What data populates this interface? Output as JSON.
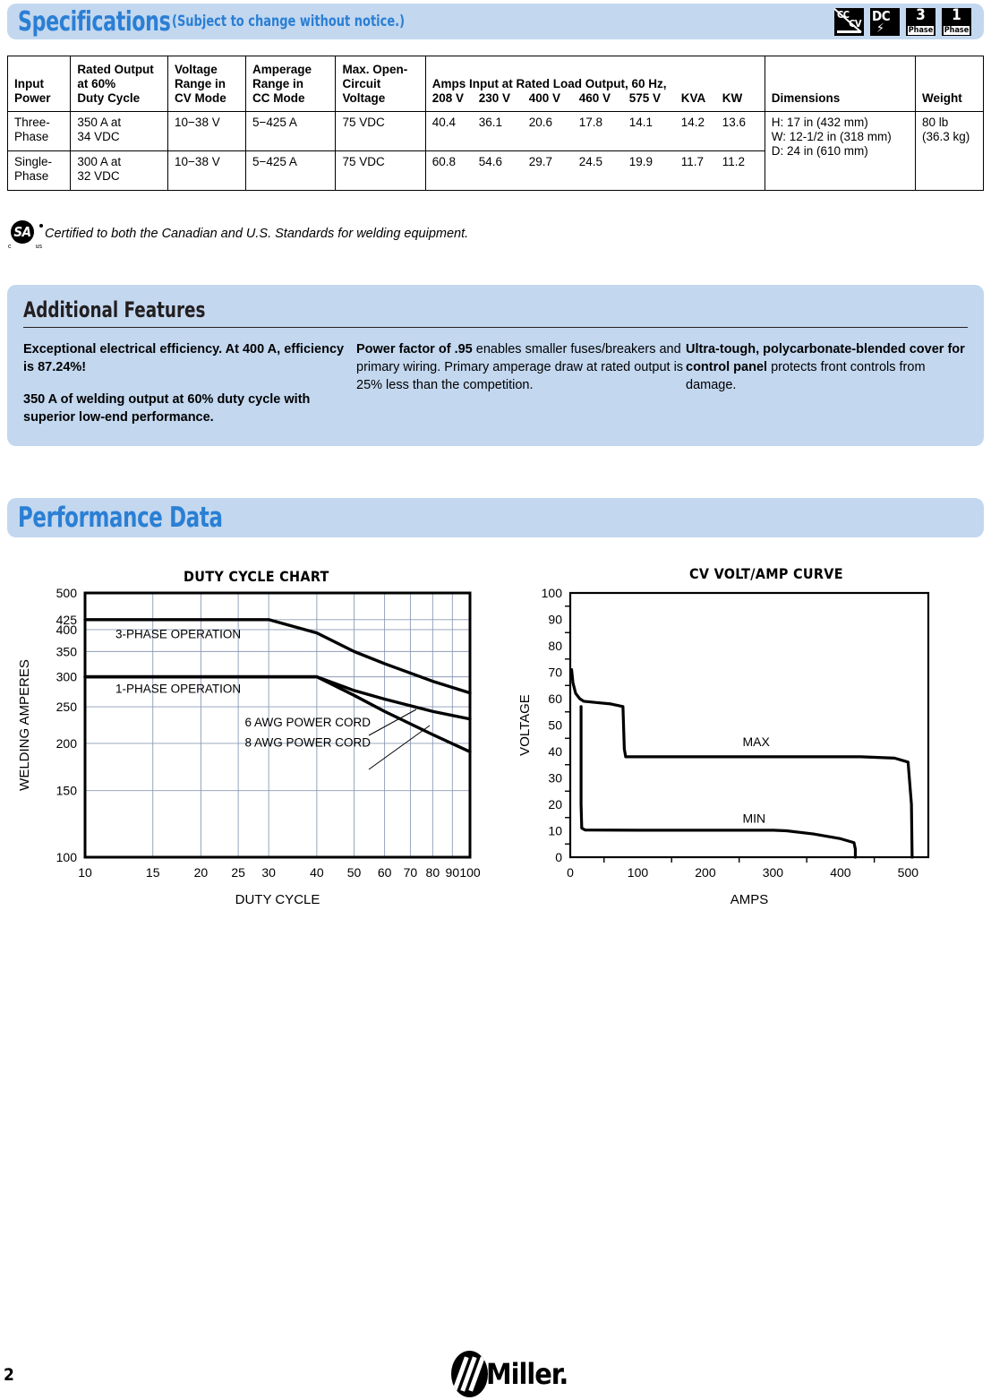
{
  "header": {
    "title": "Specifications",
    "subtitle": "(Subject to change without notice.)",
    "badges": [
      {
        "name": "cc-cv-badge",
        "top": "CC",
        "bottom": "CV"
      },
      {
        "name": "dc-badge",
        "label": "DC"
      },
      {
        "name": "three-phase-badge",
        "number": "3",
        "caption": "Phase"
      },
      {
        "name": "single-phase-badge",
        "number": "1",
        "caption": "Phase"
      }
    ]
  },
  "spec_table": {
    "columns": [
      "Input\nPower",
      "Rated Output\nat 60%\nDuty Cycle",
      "Voltage\nRange in\nCV Mode",
      "Amperage\nRange in\nCC Mode",
      "Max. Open-\nCircuit\nVoltage",
      "Amps Input at Rated Load Output, 60 Hz,",
      "Dimensions",
      "Weight"
    ],
    "col_input_power": {
      "l1": "Input",
      "l2": "Power"
    },
    "col_rated_output": {
      "l1": "Rated Output",
      "l2": "at 60%",
      "l3": "Duty Cycle"
    },
    "col_voltage_range": {
      "l1": "Voltage",
      "l2": "Range in",
      "l3": "CV Mode"
    },
    "col_amperage_range": {
      "l1": "Amperage",
      "l2": "Range in",
      "l3": "CC Mode"
    },
    "col_max_ocv": {
      "l1": "Max. Open-",
      "l2": "Circuit",
      "l3": "Voltage"
    },
    "amps_header": {
      "title": "Amps Input at Rated Load Output, 60 Hz,",
      "subheaders": [
        "208 V",
        "230 V",
        "400 V",
        "460 V",
        "575 V",
        "KVA",
        "KW"
      ]
    },
    "col_dimensions": "Dimensions",
    "col_weight": "Weight",
    "rows": [
      {
        "input_power_l1": "Three-",
        "input_power_l2": "Phase",
        "rated_output_l1": "350 A at",
        "rated_output_l2": "34 VDC",
        "voltage_range": "10−38 V",
        "amperage_range": "5−425 A",
        "max_ocv": "75 VDC",
        "amps": [
          "40.4",
          "36.1",
          "20.6",
          "17.8",
          "14.1",
          "14.2",
          "13.6"
        ]
      },
      {
        "input_power_l1": "Single-",
        "input_power_l2": "Phase",
        "rated_output_l1": "300 A at",
        "rated_output_l2": "32 VDC",
        "voltage_range": "10−38 V",
        "amperage_range": "5−425 A",
        "max_ocv": "75 VDC",
        "amps": [
          "60.8",
          "54.6",
          "29.7",
          "24.5",
          "19.9",
          "11.7",
          "11.2"
        ]
      }
    ],
    "dimensions": {
      "height": "H:  17 in (432 mm)",
      "width": "W: 12-1/2 in (318 mm)",
      "depth": "D:  24 in (610 mm)"
    },
    "weight": {
      "lb": "80 lb",
      "kg": "(36.3 kg)"
    }
  },
  "csa": {
    "mark_letters": "SA",
    "mark_c": "c",
    "mark_us": "us",
    "text": "Certified to both the Canadian and U.S. Standards for welding equipment."
  },
  "features": {
    "title": "Additional Features",
    "columns": [
      {
        "paragraphs": [
          {
            "bold": "Exceptional electrical efficiency. At 400 A, efficiency is 87.24%!",
            "rest": ""
          },
          {
            "bold": "350 A of welding output at 60% duty cycle with superior low-end performance.",
            "rest": ""
          }
        ]
      },
      {
        "paragraphs": [
          {
            "bold": "Power factor of .95",
            "rest": " enables smaller fuses/breakers and primary wiring. Primary amperage draw at rated output is 25% less than the competition."
          }
        ]
      },
      {
        "paragraphs": [
          {
            "bold": "Ultra-tough, polycarbonate-blended cover for control panel",
            "rest": " protects front controls from damage."
          }
        ]
      }
    ]
  },
  "performance": {
    "title": "Performance Data"
  },
  "chart_data": [
    {
      "type": "line",
      "name": "duty-cycle-chart",
      "title": "DUTY CYCLE CHART",
      "xlabel": "DUTY CYCLE",
      "ylabel": "WELDING AMPERES",
      "xscale": "log",
      "yscale": "log",
      "xlim": [
        10,
        100
      ],
      "ylim": [
        100,
        500
      ],
      "xticks": [
        10,
        15,
        20,
        25,
        30,
        40,
        50,
        60,
        70,
        80,
        90,
        100
      ],
      "yticks": [
        100,
        150,
        200,
        250,
        300,
        350,
        400,
        425,
        500
      ],
      "grid": true,
      "annotations": [
        {
          "text": "3-PHASE OPERATION",
          "x": 12,
          "y": 380
        },
        {
          "text": "1-PHASE OPERATION",
          "x": 12,
          "y": 272
        },
        {
          "text": "6 AWG POWER CORD",
          "x": 26,
          "y": 222
        },
        {
          "text": "8 AWG POWER CORD",
          "x": 26,
          "y": 196
        }
      ],
      "series": [
        {
          "name": "3-PHASE OPERATION",
          "points": [
            [
              10,
              425
            ],
            [
              30,
              425
            ],
            [
              40,
              392
            ],
            [
              50,
              350
            ],
            [
              60,
              325
            ],
            [
              80,
              292
            ],
            [
              100,
              272
            ]
          ]
        },
        {
          "name": "6 AWG POWER CORD",
          "points": [
            [
              10,
              300
            ],
            [
              40,
              300
            ],
            [
              50,
              276
            ],
            [
              60,
              262
            ],
            [
              80,
              243
            ],
            [
              100,
              232
            ]
          ]
        },
        {
          "name": "8 AWG POWER CORD",
          "points": [
            [
              10,
              300
            ],
            [
              40,
              300
            ],
            [
              50,
              268
            ],
            [
              60,
              243
            ],
            [
              80,
              211
            ],
            [
              100,
              190
            ]
          ]
        }
      ]
    },
    {
      "type": "line",
      "name": "cv-volt-amp-curve",
      "title": "CV VOLT/AMP CURVE",
      "xlabel": "AMPS",
      "ylabel": "VOLTAGE",
      "xscale": "linear",
      "yscale": "linear",
      "xlim": [
        0,
        530
      ],
      "ylim": [
        0,
        100
      ],
      "xticks": [
        0,
        100,
        200,
        300,
        400,
        500
      ],
      "yticks": [
        0,
        10,
        20,
        30,
        40,
        50,
        60,
        70,
        80,
        90,
        100
      ],
      "grid": false,
      "annotations": [
        {
          "text": "MAX",
          "x": 255,
          "y": 42
        },
        {
          "text": "MIN",
          "x": 255,
          "y": 13
        }
      ],
      "series": [
        {
          "name": "MAX",
          "points": [
            [
              2,
              71
            ],
            [
              4,
              66
            ],
            [
              8,
              62
            ],
            [
              14,
              60
            ],
            [
              20,
              59
            ],
            [
              40,
              58.5
            ],
            [
              60,
              58
            ],
            [
              78,
              57
            ],
            [
              80,
              41
            ],
            [
              82,
              38
            ],
            [
              150,
              38
            ],
            [
              300,
              38
            ],
            [
              430,
              38
            ],
            [
              480,
              37.5
            ],
            [
              500,
              36
            ],
            [
              505,
              20
            ],
            [
              506,
              0
            ]
          ]
        },
        {
          "name": "MIN",
          "points": [
            [
              16,
              57
            ],
            [
              16,
              20
            ],
            [
              17,
              11
            ],
            [
              22,
              10.3
            ],
            [
              100,
              10.2
            ],
            [
              200,
              10.2
            ],
            [
              300,
              10.2
            ],
            [
              320,
              10
            ],
            [
              360,
              8.8
            ],
            [
              400,
              7
            ],
            [
              420,
              5.5
            ],
            [
              422,
              3
            ],
            [
              422,
              0
            ]
          ]
        }
      ]
    }
  ],
  "footer": {
    "page_number": "2",
    "logo_text": "Miller."
  }
}
